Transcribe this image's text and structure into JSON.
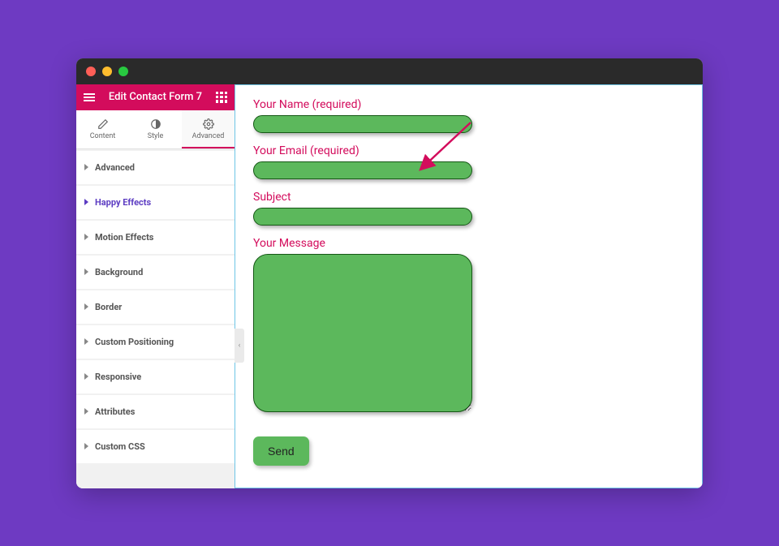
{
  "header": {
    "title": "Edit Contact Form 7"
  },
  "tabs": [
    {
      "label": "Content"
    },
    {
      "label": "Style"
    },
    {
      "label": "Advanced"
    }
  ],
  "panels": [
    {
      "label": "Advanced"
    },
    {
      "label": "Happy Effects"
    },
    {
      "label": "Motion Effects"
    },
    {
      "label": "Background"
    },
    {
      "label": "Border"
    },
    {
      "label": "Custom Positioning"
    },
    {
      "label": "Responsive"
    },
    {
      "label": "Attributes"
    },
    {
      "label": "Custom CSS"
    }
  ],
  "form": {
    "name_label": "Your Name (required)",
    "email_label": "Your Email (required)",
    "subject_label": "Subject",
    "message_label": "Your Message",
    "submit": "Send"
  },
  "collapse_symbol": "‹"
}
